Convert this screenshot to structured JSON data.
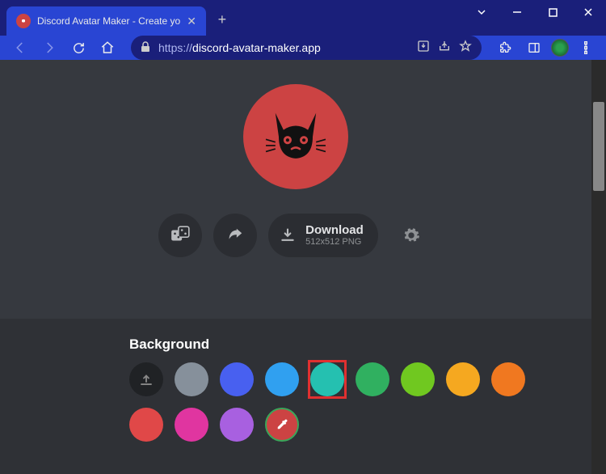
{
  "window": {
    "tab_title": "Discord Avatar Maker - Create yo"
  },
  "toolbar": {
    "url_scheme": "https://",
    "url_host": "discord-avatar-maker.app"
  },
  "actions": {
    "download_label": "Download",
    "download_sub": "512x512 PNG"
  },
  "background": {
    "heading": "Background",
    "colors": [
      "#86909b",
      "#4860f0",
      "#30a0f0",
      "#25c0b0",
      "#30b060",
      "#70c820",
      "#f5a820",
      "#f07820",
      "#e04848",
      "#e035a0",
      "#a860e0"
    ],
    "selected_index": 3
  }
}
